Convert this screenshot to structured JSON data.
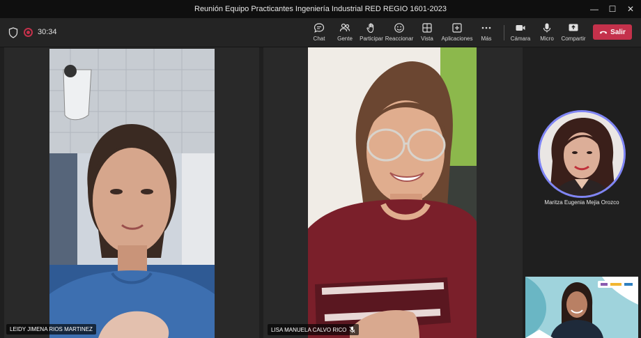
{
  "window": {
    "title": "Reunión Equipo Practicantes Ingeniería Industrial RED REGIO 1601-2023",
    "controls": {
      "minimize": "—",
      "maximize": "☐",
      "close": "✕"
    }
  },
  "toolbar": {
    "timer": "30:34",
    "buttons": {
      "chat": "Chat",
      "people": "Gente",
      "raise": "Participar",
      "react": "Reaccionar",
      "view": "Vista",
      "apps": "Aplicaciones",
      "more": "Más",
      "camera": "Cámara",
      "mic": "Micro",
      "share": "Compartir"
    },
    "leave_label": "Salir"
  },
  "participants": {
    "p1": {
      "name": "LEIDY JIMENA RIOS MARTINEZ"
    },
    "p2": {
      "name": "LISA MANUELA CALVO RICO",
      "muted": true
    },
    "p3": {
      "name": "Maritza Eugenia Mejia Orozco"
    }
  },
  "colors": {
    "leave": "#c4314b",
    "avatar_ring": "#7f85f5",
    "shirt_blue": "#3d6fb0",
    "shirt_maroon": "#7a1f2a"
  }
}
